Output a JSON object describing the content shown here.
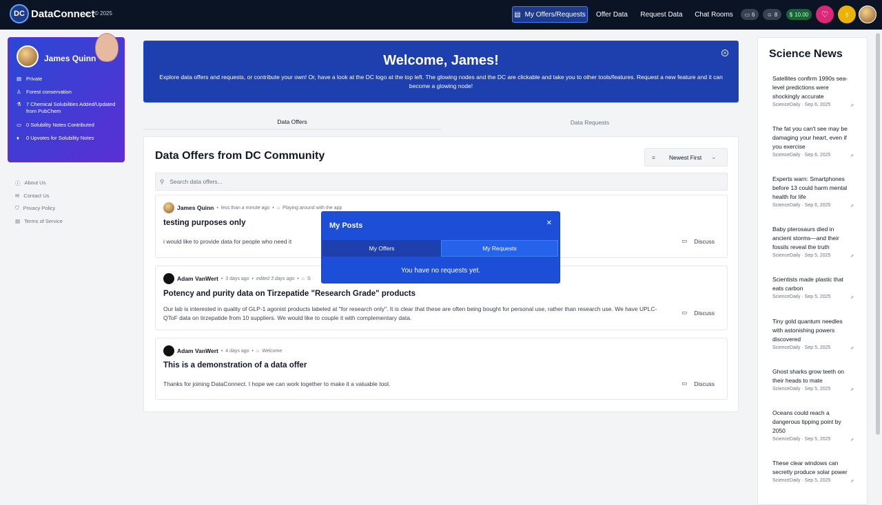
{
  "topbar": {
    "brand": "DataConnect",
    "logo": "DC",
    "copyright": "© 2025",
    "nav": [
      "My Offers/Requests",
      "Offer Data",
      "Request Data",
      "Chat Rooms"
    ],
    "messages": "6",
    "users": "8",
    "balance": "10.00",
    "currency": "$"
  },
  "profile": {
    "name": "James Quinn",
    "items": [
      "Private",
      "Forest conservation",
      "7 Chemical Solubilities Added/Updated from PubChem",
      "0 Solubility Notes Contributed",
      "0 Upvotes for Solubility Notes"
    ]
  },
  "footer_links": [
    "About Us",
    "Contact Us",
    "Privacy Policy",
    "Terms of Service"
  ],
  "welcome": {
    "title": "Welcome, James!",
    "text": "Explore data offers and requests, or contribute your own! Or, have a look at the DC logo at the top left. The glowing nodes and the DC are clickable and take you to other tools/features. Request a new feature and it can become a glowing node!"
  },
  "tabs": [
    "Data Offers",
    "Data Requests"
  ],
  "main": {
    "title": "Data Offers from DC Community",
    "sort": "Newest First",
    "search_placeholder": "Search data offers...",
    "discuss": "Discuss"
  },
  "posts": [
    {
      "author": "James Quinn",
      "time": "less than a minute ago",
      "tag": "Playing around with the app",
      "title": "testing purposes only",
      "body": "i would like to provide data for people who need it"
    },
    {
      "author": "Adam VanWert",
      "time": "3 days ago",
      "edited": "edited 3 days ago",
      "tag": "S",
      "title": "Potency and purity data on Tirzepatide \"Research Grade\" products",
      "body": "Our lab is interested in quality of GLP-1 agonist products labeled at \"for research only\". It is clear that these are often being bought for personal use, rather than research use. We have UPLC-QToF data on tirzepatide from 10 suppliers. We would like to couple it with complementary data."
    },
    {
      "author": "Adam VanWert",
      "time": "4 days ago",
      "tag": "Welcome",
      "title": "This is a demonstration of a data offer",
      "body": "Thanks for joining DataConnect. I hope we can work together to make it a valuable tool."
    }
  ],
  "modal": {
    "title": "My Posts",
    "tabs": [
      "My Offers",
      "My Requests"
    ],
    "empty": "You have no requests yet."
  },
  "news": {
    "title": "Science News",
    "items": [
      {
        "headline": "Satellites confirm 1990s sea-level predictions were shockingly accurate",
        "meta": "ScienceDaily · Sep 6, 2025"
      },
      {
        "headline": "The fat you can't see may be damaging your heart, even if you exercise",
        "meta": "ScienceDaily · Sep 6, 2025"
      },
      {
        "headline": "Experts warn: Smartphones before 13 could harm mental health for life",
        "meta": "ScienceDaily · Sep 6, 2025"
      },
      {
        "headline": "Baby pterosaurs died in ancient storms—and their fossils reveal the truth",
        "meta": "ScienceDaily · Sep 5, 2025"
      },
      {
        "headline": "Scientists made plastic that eats carbon",
        "meta": "ScienceDaily · Sep 5, 2025"
      },
      {
        "headline": "Tiny gold quantum needles with astonishing powers discovered",
        "meta": "ScienceDaily · Sep 5, 2025"
      },
      {
        "headline": "Ghost sharks grow teeth on their heads to mate",
        "meta": "ScienceDaily · Sep 5, 2025"
      },
      {
        "headline": "Oceans could reach a dangerous tipping point by 2050",
        "meta": "ScienceDaily · Sep 5, 2025"
      },
      {
        "headline": "These clear windows can secretly produce solar power",
        "meta": "ScienceDaily · Sep 5, 2025"
      }
    ]
  }
}
